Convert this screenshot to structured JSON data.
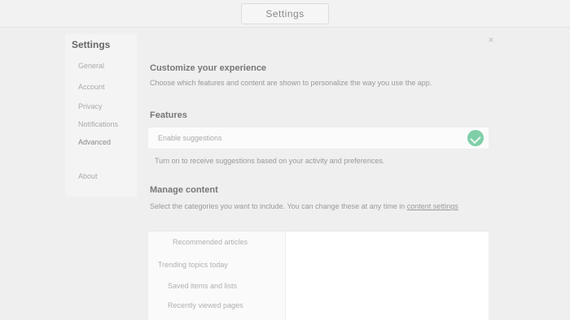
{
  "window": {
    "title": "Settings"
  },
  "sidebar": {
    "title": "Settings",
    "items": [
      {
        "label": "General"
      },
      {
        "label": "Account"
      },
      {
        "label": "Privacy"
      },
      {
        "label": "Notifications"
      },
      {
        "label": "Advanced"
      },
      {
        "label": "About"
      }
    ]
  },
  "close": {
    "label": "×"
  },
  "section1": {
    "heading": "Customize your experience",
    "description": "Choose which features and content are shown to personalize the way you use the app."
  },
  "section2": {
    "heading": "Features",
    "field_label": "Enable suggestions",
    "toggle_on": true,
    "note": "Turn on to receive suggestions based on your activity and preferences."
  },
  "section3": {
    "heading": "Manage content",
    "description": "Select the categories you want to include. You can change these at any time in",
    "link": "content settings",
    "items": [
      {
        "label": "Recommended articles"
      },
      {
        "label": "Trending topics today"
      },
      {
        "label": "Saved items and lists"
      },
      {
        "label": "Recently viewed pages"
      }
    ]
  }
}
